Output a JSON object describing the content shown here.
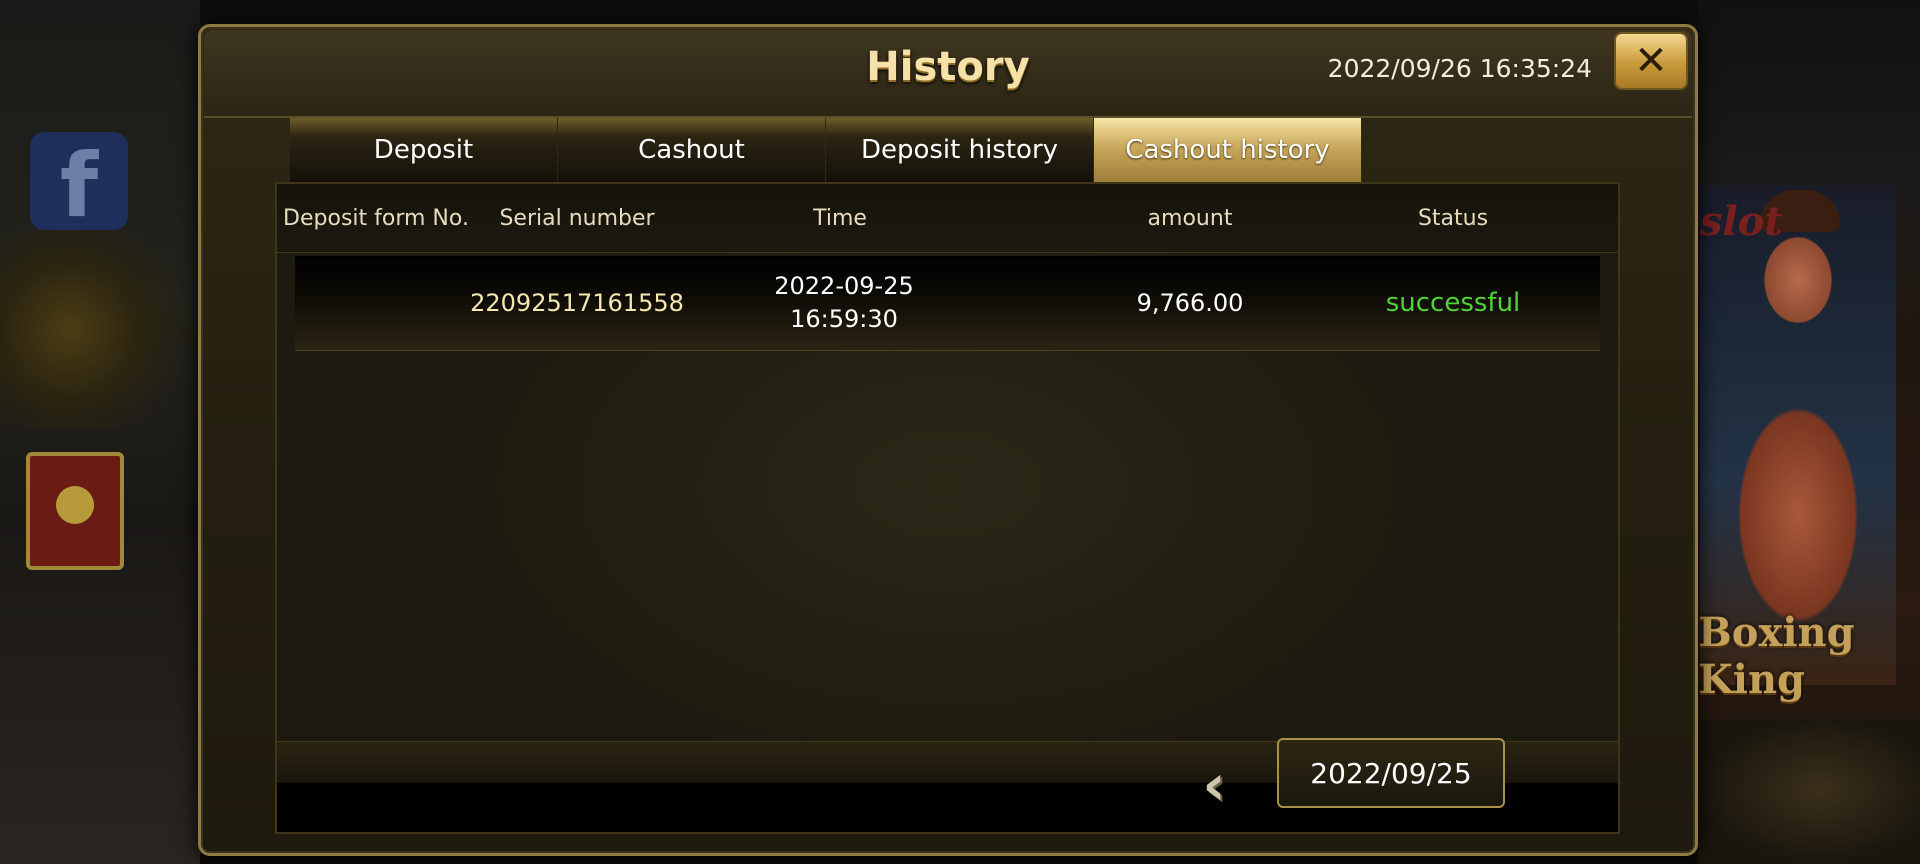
{
  "background": {
    "social_icon": "facebook-icon",
    "game_watermark": "slot",
    "game_logo": "Boxing King"
  },
  "modal": {
    "title": "History",
    "clock": "2022/09/26 16:35:24",
    "close_label": "✕"
  },
  "tabs": [
    {
      "label": "Deposit",
      "active": false
    },
    {
      "label": "Cashout",
      "active": false
    },
    {
      "label": "Deposit history",
      "active": false
    },
    {
      "label": "Cashout history",
      "active": true
    }
  ],
  "table": {
    "columns": [
      "Deposit form No.",
      "Serial number",
      "Time",
      "amount",
      "Status"
    ],
    "rows": [
      {
        "deposit_form_no": "",
        "serial_number": "22092517161558",
        "time_date": "2022-09-25",
        "time_clock": "16:59:30",
        "amount": "9,766.00",
        "status": "successful"
      }
    ]
  },
  "footer": {
    "prev_icon": "chevron-left-icon",
    "prev_glyph": "‹",
    "selected_date": "2022/09/25"
  },
  "colors": {
    "accent_gold": "#c9a85c",
    "status_success": "#4fd336",
    "panel_bg": "#1d1a0f"
  }
}
